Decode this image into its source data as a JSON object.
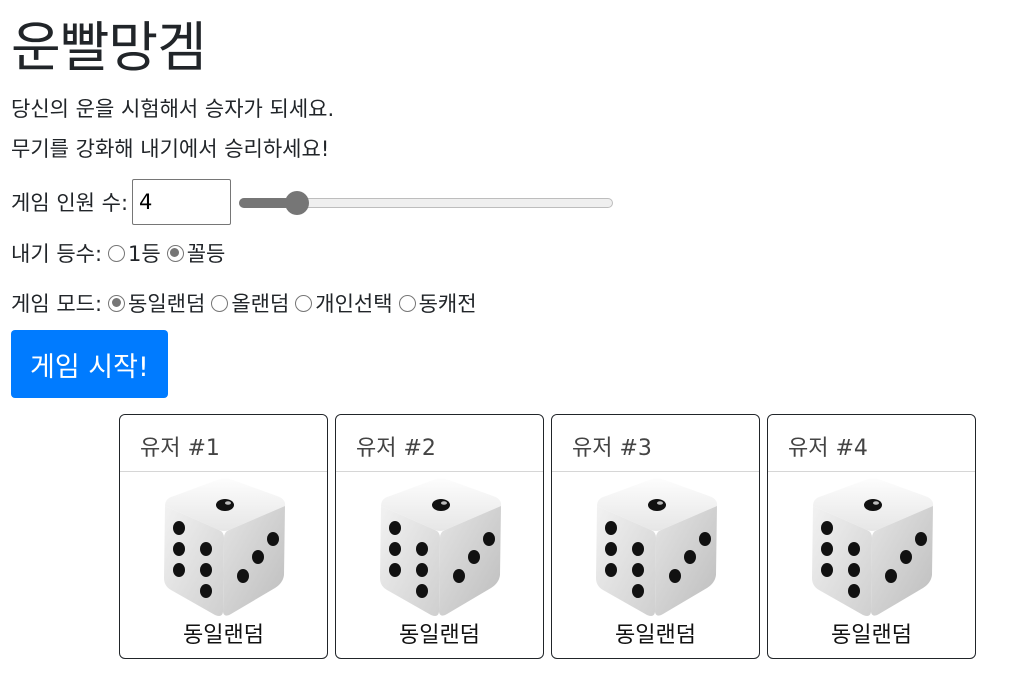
{
  "title": "운빨망겜",
  "intro": {
    "line1": "당신의 운을 시험해서 승자가 되세요.",
    "line2": "무기를 강화해 내기에서 승리하세요!"
  },
  "players": {
    "label": "게임 인원 수:",
    "value": "4",
    "slider_fraction": 0.13
  },
  "rank": {
    "label": "내기 등수:",
    "options": [
      {
        "label": "1등",
        "checked": false
      },
      {
        "label": "꼴등",
        "checked": true
      }
    ]
  },
  "mode": {
    "label": "게임 모드:",
    "options": [
      {
        "label": "동일랜덤",
        "checked": true
      },
      {
        "label": "올랜덤",
        "checked": false
      },
      {
        "label": "개인선택",
        "checked": false
      },
      {
        "label": "동캐전",
        "checked": false
      }
    ]
  },
  "start_button": "게임 시작!",
  "cards": [
    {
      "title": "유저 #1",
      "mode": "동일랜덤"
    },
    {
      "title": "유저 #2",
      "mode": "동일랜덤"
    },
    {
      "title": "유저 #3",
      "mode": "동일랜덤"
    },
    {
      "title": "유저 #4",
      "mode": "동일랜덤"
    }
  ],
  "colors": {
    "accent": "#007bff",
    "control_gray": "#767676"
  },
  "icons": {
    "dice": "dice-icon"
  }
}
